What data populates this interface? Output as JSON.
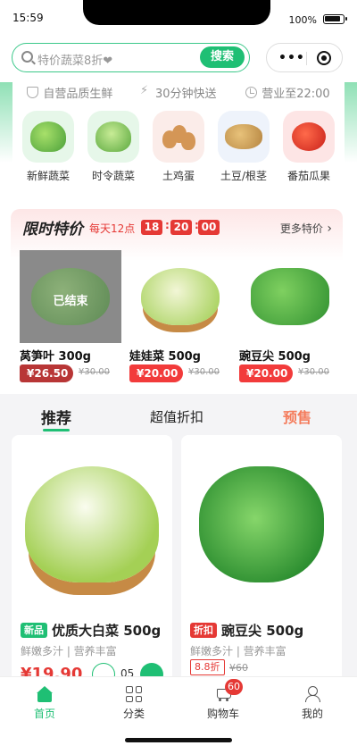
{
  "status_bar": {
    "time": "15:59",
    "battery": "100%"
  },
  "search": {
    "placeholder": "特价蔬菜8折❤",
    "button_label": "搜索"
  },
  "capsule": {
    "more": "•••"
  },
  "features": [
    {
      "icon": "shield-icon",
      "label": "自营品质生鲜"
    },
    {
      "icon": "bolt-icon",
      "label": "30分钟快送"
    },
    {
      "icon": "clock-icon",
      "label": "营业至22:00"
    }
  ],
  "categories": [
    {
      "label": "新鲜蔬菜",
      "icon": "vegetables-icon"
    },
    {
      "label": "时令蔬菜",
      "icon": "seasonal-vegetables-icon"
    },
    {
      "label": "土鸡蛋",
      "icon": "eggs-icon"
    },
    {
      "label": "土豆/根茎",
      "icon": "potato-icon"
    },
    {
      "label": "番茄瓜果",
      "icon": "tomato-icon"
    }
  ],
  "flash_sale": {
    "title": "限时特价",
    "subtitle": "每天12点",
    "countdown": {
      "hours": "18",
      "minutes": "20",
      "seconds": "00",
      "sep": ":"
    },
    "more_label": "更多特价",
    "items": [
      {
        "name": "莴笋叶 300g",
        "price": "¥26.50",
        "old_price": "¥30.00",
        "ended_label": "已结束"
      },
      {
        "name": "娃娃菜 500g",
        "price": "¥20.00",
        "old_price": "¥30.00"
      },
      {
        "name": "豌豆尖 500g",
        "price": "¥20.00",
        "old_price": "¥30.00"
      }
    ]
  },
  "tabs": [
    {
      "label": "推荐"
    },
    {
      "label": "超值折扣"
    },
    {
      "label": "预售"
    }
  ],
  "products": [
    {
      "tag": "新品",
      "title": "优质大白菜 500g",
      "desc": "鲜嫩多汁 | 营养丰富",
      "price": "¥19.90",
      "quantity": "05"
    },
    {
      "tag": "折扣",
      "title": "豌豆尖 500g",
      "desc": "鲜嫩多汁 | 营养丰富",
      "discount": "8.8折",
      "old_price": "¥60"
    }
  ],
  "tabbar": [
    {
      "label": "首页",
      "icon": "home-icon"
    },
    {
      "label": "分类",
      "icon": "grid-icon"
    },
    {
      "label": "购物车",
      "icon": "cart-icon",
      "badge": "60"
    },
    {
      "label": "我的",
      "icon": "user-icon"
    }
  ],
  "colors": {
    "brand_green": "#1fbf74",
    "sale_red": "#e53935",
    "presale_orange": "#f47c5c"
  }
}
